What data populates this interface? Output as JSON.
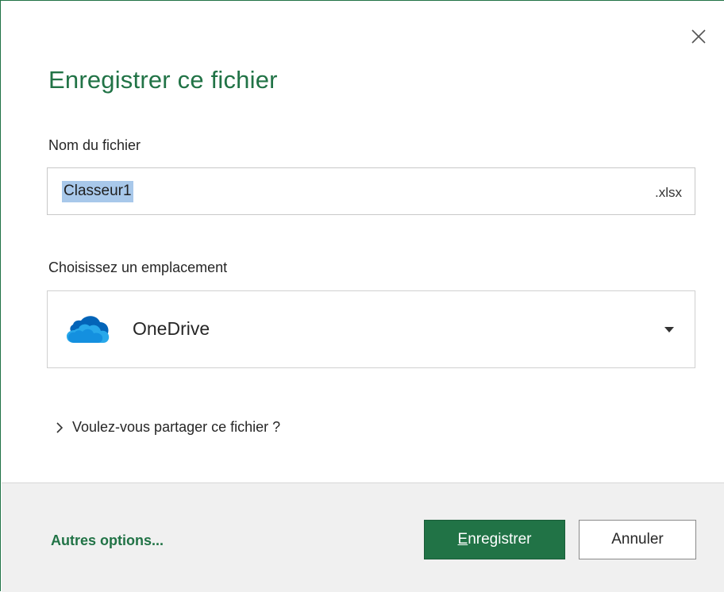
{
  "dialog": {
    "title": "Enregistrer ce fichier",
    "close_icon": "close-icon"
  },
  "filename": {
    "label": "Nom du fichier",
    "value": "Classeur1",
    "extension": ".xlsx"
  },
  "location": {
    "label": "Choisissez un emplacement",
    "selected": "OneDrive",
    "icon": "onedrive-cloud-icon"
  },
  "share": {
    "label": "Voulez-vous partager ce fichier ?",
    "icon": "chevron-right-icon"
  },
  "footer": {
    "more_options": "Autres options...",
    "save_button_first": "E",
    "save_button_rest": "nregistrer",
    "cancel_button": "Annuler"
  },
  "colors": {
    "accent": "#217346",
    "onedrive_blue": "#0364b8",
    "selection": "#a8c8ea"
  }
}
